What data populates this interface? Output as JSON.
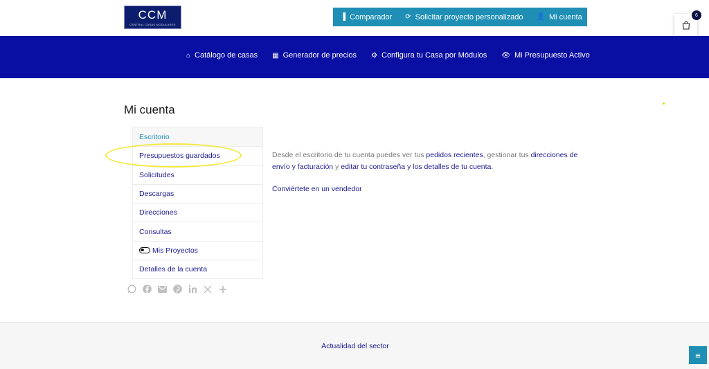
{
  "logo": {
    "title": "CCM",
    "subtitle": "CENTRAL CASAS MODULARES"
  },
  "top_nav": [
    {
      "icon": "bar-chart-icon",
      "glyph": "▐",
      "label": "Comparador"
    },
    {
      "icon": "refresh-icon",
      "glyph": "⟳",
      "label": "Solicitar proyecto personalizado"
    },
    {
      "icon": "user-icon",
      "glyph": "👤",
      "label": "Mi cuenta"
    }
  ],
  "cart": {
    "count": "6"
  },
  "main_nav": [
    {
      "icon": "houses-icon",
      "glyph": "⌂",
      "label": "Catálogo de casas"
    },
    {
      "icon": "calculator-icon",
      "glyph": "▦",
      "label": "Generador de precios"
    },
    {
      "icon": "gear-icon",
      "glyph": "⚙",
      "label": "Configura tu Casa por Módulos"
    },
    {
      "icon": "eye-icon",
      "glyph": "👁",
      "label": "Mi Presupuesto Activo"
    }
  ],
  "page_title": "Mi cuenta",
  "account_menu": [
    {
      "label": "Escritorio"
    },
    {
      "label": "Presupuestos guardados"
    },
    {
      "label": "Solicitudes"
    },
    {
      "label": "Descargas"
    },
    {
      "label": "Direcciones"
    },
    {
      "label": "Consultas"
    },
    {
      "label": "Mis Proyectos"
    },
    {
      "label": "Detalles de la cuenta"
    }
  ],
  "dashboard": {
    "t1": "Desde el escritorio de tu cuenta puedes ver tus ",
    "l1": "pedidos recientes",
    "t2": ", gestionar tus ",
    "l2": "direcciones de envío y facturación",
    "t3": " y ",
    "l3": "editar tu contraseña y los detalles de tu cuenta",
    "t4": ".",
    "vendor_link": "Conviértete en un vendedor"
  },
  "footer": {
    "link": "Actualidad del sector"
  },
  "colors": {
    "nav_blue": "#0a0fa3",
    "accent": "#1f8fb5",
    "link": "#1b1b8f",
    "highlight": "#f2ea3c"
  }
}
